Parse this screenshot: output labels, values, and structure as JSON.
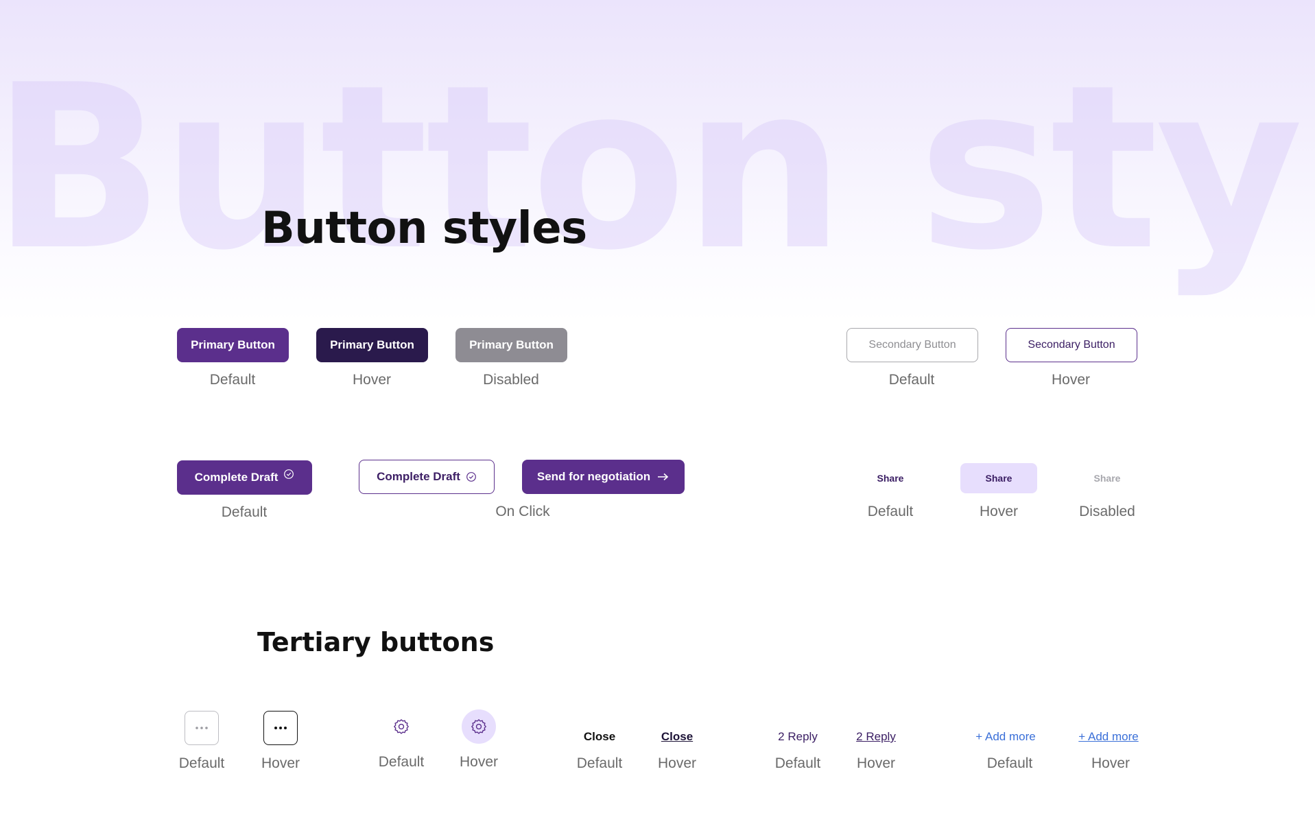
{
  "watermark": "Button styles",
  "title": "Button styles",
  "primary": {
    "label": "Primary Button",
    "states": [
      "Default",
      "Hover",
      "Disabled"
    ]
  },
  "secondary": {
    "label": "Secondary Button",
    "states": [
      "Default",
      "Hover"
    ]
  },
  "draft": {
    "label": "Complete Draft",
    "send_label": "Send for negotiation",
    "state_default": "Default",
    "state_click": "On Click"
  },
  "share": {
    "label": "Share",
    "states": [
      "Default",
      "Hover",
      "Disabled"
    ]
  },
  "tertiary": {
    "title": "Tertiary buttons",
    "close_label": "Close",
    "reply_label": "2 Reply",
    "add_label": "+ Add more",
    "state_default": "Default",
    "state_hover": "Hover"
  },
  "icons": {
    "check": "check-circle-icon",
    "arrow": "arrow-right-icon",
    "more": "more-horizontal-icon",
    "settings": "gear-icon"
  },
  "colors": {
    "brand": "#5b2f8c",
    "brand_dark": "#2a1a4c",
    "disabled": "#8e8c93",
    "share_hover_bg": "#e7defd",
    "link": "#3a6fd8"
  }
}
